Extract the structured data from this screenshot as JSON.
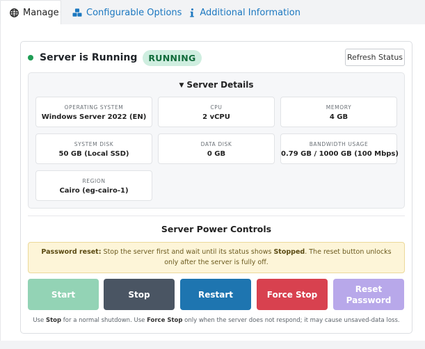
{
  "tabs": [
    {
      "label": "Manage",
      "icon": "globe-icon",
      "active": true
    },
    {
      "label": "Configurable Options",
      "icon": "cubes-icon",
      "active": false
    },
    {
      "label": "Additional Information",
      "icon": "info-icon",
      "active": false
    }
  ],
  "status": {
    "title": "Server is Running",
    "badge": "RUNNING",
    "refresh_label": "Refresh Status"
  },
  "details": {
    "header": "Server Details",
    "items": [
      {
        "label": "OPERATING SYSTEM",
        "value": "Windows Server 2022 (EN)"
      },
      {
        "label": "CPU",
        "value": "2 vCPU"
      },
      {
        "label": "MEMORY",
        "value": "4 GB"
      },
      {
        "label": "SYSTEM DISK",
        "value": "50 GB (Local SSD)"
      },
      {
        "label": "DATA DISK",
        "value": "0 GB"
      },
      {
        "label": "BANDWIDTH USAGE",
        "value": "0.79 GB / 1000 GB (100 Mbps)"
      },
      {
        "label": "REGION",
        "value": "Cairo (eg-cairo-1)"
      }
    ]
  },
  "power": {
    "title": "Server Power Controls",
    "warning": {
      "lead": "Password reset:",
      "text1": " Stop the server first and wait until its status shows ",
      "strong": "Stopped",
      "text2": ". The reset button unlocks only after the server is fully off."
    },
    "buttons": {
      "start": "Start",
      "stop": "Stop",
      "restart": "Restart",
      "force_stop": "Force Stop",
      "reset_line1": "Reset",
      "reset_line2": "Password"
    },
    "footnote": {
      "p1": "Use ",
      "b1": "Stop",
      "p2": " for a normal shutdown. Use ",
      "b2": "Force Stop",
      "p3": " only when the server does not respond; it may cause unsaved-data loss."
    }
  },
  "colors": {
    "running_dot": "#1f9d55",
    "start": "#93d3b5",
    "stop": "#4a5563",
    "restart": "#1e75b0",
    "force_stop": "#d8414f",
    "reset_password": "#b8a8ea",
    "link": "#1c78c0"
  }
}
